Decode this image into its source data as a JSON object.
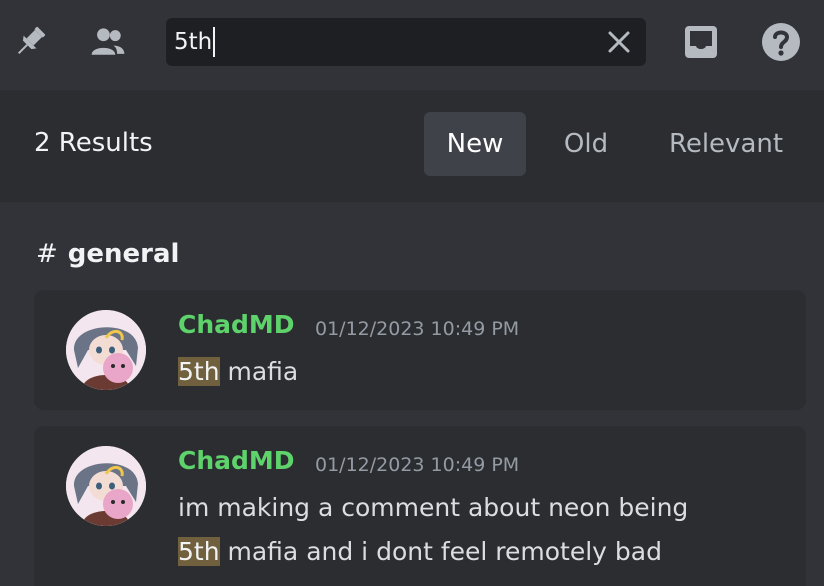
{
  "topbar": {
    "icons": [
      "pin-icon",
      "members-icon",
      "inbox-icon",
      "help-icon"
    ],
    "search": {
      "value": "5th",
      "placeholder": "Search"
    }
  },
  "results": {
    "count_label": "2 Results",
    "tabs": [
      {
        "label": "New",
        "active": true
      },
      {
        "label": "Old",
        "active": false
      },
      {
        "label": "Relevant",
        "active": false
      }
    ]
  },
  "channel": {
    "hash": "#",
    "name": "general"
  },
  "messages": [
    {
      "author": "ChadMD",
      "timestamp": "01/12/2023 10:49 PM",
      "lines": [
        {
          "highlight": "5th",
          "rest": " mafia"
        }
      ]
    },
    {
      "author": "ChadMD",
      "timestamp": "01/12/2023 10:49 PM",
      "lines": [
        {
          "highlight": "",
          "rest": "im making a comment about neon being"
        },
        {
          "highlight": "5th",
          "rest": " mafia and i dont feel remotely bad"
        }
      ]
    }
  ],
  "colors": {
    "background": "#313338",
    "panel": "#2b2d31",
    "author": "#5ed36b",
    "highlight": "#70603e",
    "active_tab": "#404249"
  }
}
